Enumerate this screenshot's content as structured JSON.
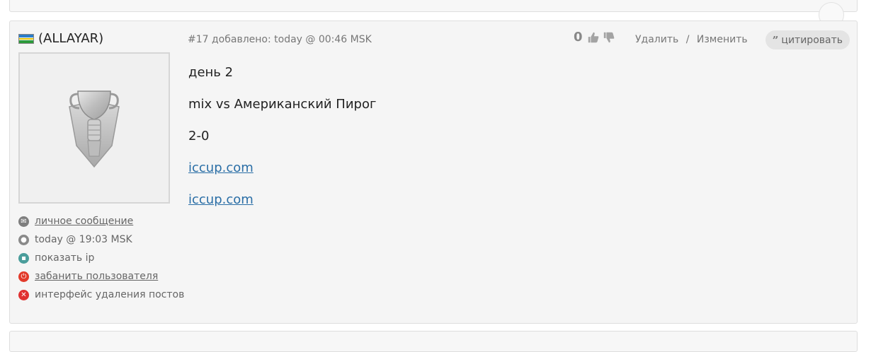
{
  "post": {
    "username": "(ALLAYAR)",
    "meta": "#17 добавлено: today @ 00:46 MSK",
    "rating": "0",
    "delete_label": "Удалить",
    "separator": "/",
    "edit_label": "Изменить",
    "quote_label": "цитировать",
    "body_lines": [
      "день 2",
      "mix vs Американский Пирог",
      "2-0"
    ],
    "links": [
      "iccup.com",
      "iccup.com"
    ]
  },
  "user_links": {
    "message": "личное сообщение",
    "last_seen": "today @ 19:03 MSK",
    "show_ip": "показать ip",
    "ban": "забанить пользователя",
    "delete_interface": "интерфейс удаления постов"
  },
  "icons": {
    "flag": "flag-icon",
    "mail": "mail-icon",
    "clock": "clock-icon",
    "ip": "ip-icon",
    "ban": "power-icon",
    "delete": "close-icon",
    "like": "thumbs-up-icon",
    "dislike": "thumbs-down-icon",
    "quote": "quote-icon"
  },
  "colors": {
    "link": "#2a6ea6",
    "ban": "#e23a2a",
    "delete": "#e03131",
    "ip": "#4a9d9b"
  }
}
